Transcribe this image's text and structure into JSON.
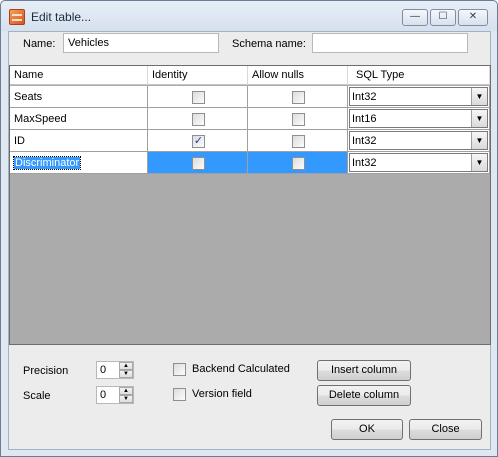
{
  "window": {
    "title": "Edit table...",
    "min_glyph": "—",
    "max_glyph": "☐",
    "close_glyph": "✕"
  },
  "form": {
    "name_label": "Name:",
    "name_value": "Vehicles",
    "schema_label": "Schema name:",
    "schema_value": ""
  },
  "grid": {
    "columns": [
      "Name",
      "Identity",
      "Allow nulls",
      "SQL Type"
    ],
    "rows": [
      {
        "name": "Seats",
        "identity": false,
        "allow_nulls": false,
        "sql_type": "Int32",
        "selected": false
      },
      {
        "name": "MaxSpeed",
        "identity": false,
        "allow_nulls": false,
        "sql_type": "Int16",
        "selected": false
      },
      {
        "name": "ID",
        "identity": true,
        "allow_nulls": false,
        "sql_type": "Int32",
        "selected": false
      },
      {
        "name": "Discriminator",
        "identity": false,
        "allow_nulls": false,
        "sql_type": "Int32",
        "selected": true
      }
    ],
    "check_glyph": "✓",
    "dropdown_glyph": "▼",
    "selection_color": "#3399ff",
    "empty_area_color": "#ababab"
  },
  "options": {
    "precision_label": "Precision",
    "precision_value": "0",
    "scale_label": "Scale",
    "scale_value": "0",
    "backend_calculated_label": "Backend Calculated",
    "version_field_label": "Version field",
    "spin_up_glyph": "▲",
    "spin_down_glyph": "▼"
  },
  "buttons": {
    "insert_column": "Insert column",
    "delete_column": "Delete column",
    "ok": "OK",
    "close": "Close"
  }
}
